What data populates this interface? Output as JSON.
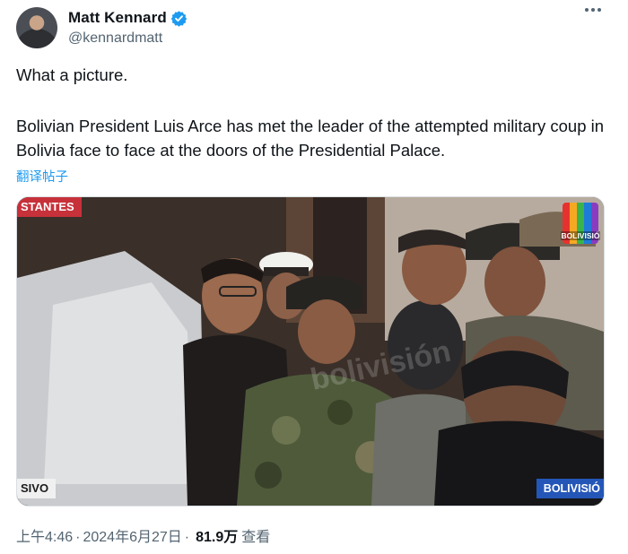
{
  "author": {
    "name": "Matt Kennard",
    "handle": "@kennardmatt",
    "verified": true
  },
  "tweet": {
    "line1": "What a picture.",
    "line2": "Bolivian President Luis Arce has met the leader of the attempted military coup in Bolivia face to face at the doors of the Presidential Palace.",
    "translate_label": "翻译帖子"
  },
  "media": {
    "ticker_left": "STANTES",
    "chyron_left": "SIVO",
    "chyron_right": "BOLIVISIÓ",
    "logo_text": "BOLIVISIÓ"
  },
  "meta": {
    "time": "上午4:46",
    "date": "2024年6月27日",
    "views_count": "81.9万",
    "views_label": "查看",
    "separator": "·"
  },
  "colors": {
    "text": "#0f1419",
    "secondary": "#536471",
    "link": "#1d9bf0",
    "verified": "#1d9bf0"
  },
  "icons": {
    "verified": "verified-badge-icon",
    "more": "more-options-icon"
  }
}
